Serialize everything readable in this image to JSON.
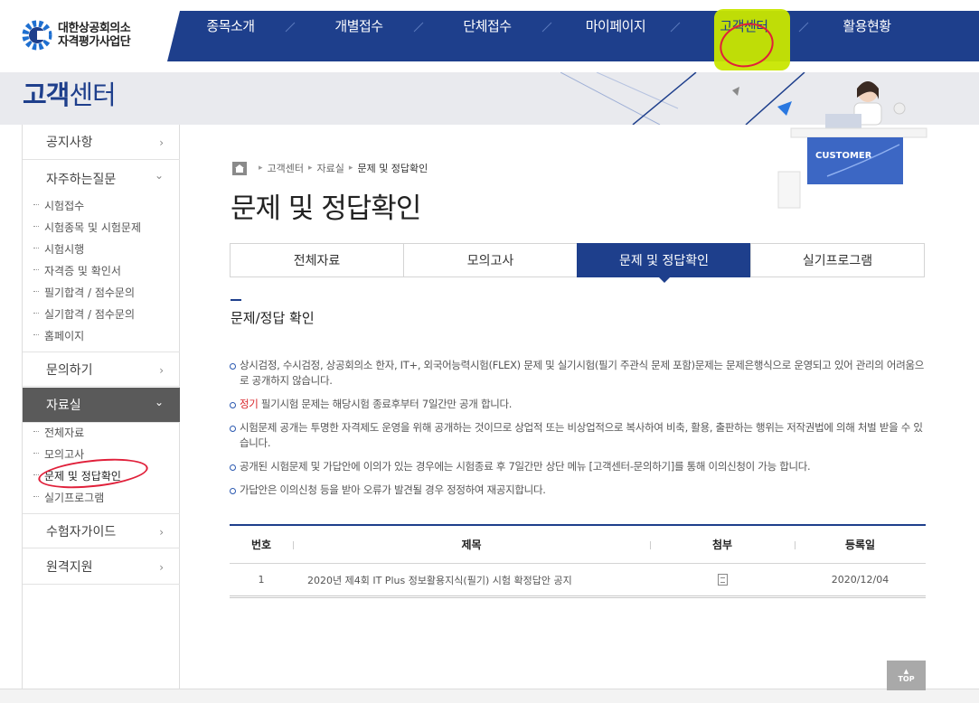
{
  "header": {
    "logo_line1": "대한상공회의소",
    "logo_line2": "자격평가사업단",
    "nav": [
      {
        "label": "종목소개"
      },
      {
        "label": "개별접수"
      },
      {
        "label": "단체접수"
      },
      {
        "label": "마이페이지"
      },
      {
        "label": "고객센터"
      },
      {
        "label": "활용현황"
      }
    ],
    "nav_color": "#1e3f8c"
  },
  "banner": {
    "title_bold": "고객",
    "title_rest": "센터",
    "art_label": "CUSTOMER"
  },
  "sidebar": {
    "items": [
      {
        "label": "공지사항",
        "chevron": "›"
      },
      {
        "label": "자주하는질문",
        "chevron": "⌄"
      },
      {
        "label": "문의하기",
        "chevron": "›"
      },
      {
        "label": "자료실",
        "chevron": "⌄"
      },
      {
        "label": "수험자가이드",
        "chevron": "›"
      },
      {
        "label": "원격지원",
        "chevron": "›"
      }
    ],
    "faq_sub": [
      "시험접수",
      "시험종목 및 시험문제",
      "시험시행",
      "자격증 및 확인서",
      "필기합격 / 점수문의",
      "실기합격 / 점수문의",
      "홈페이지"
    ],
    "archive_sub": [
      "전체자료",
      "모의고사",
      "문제 및 정답확인",
      "실기프로그램"
    ]
  },
  "breadcrumb": {
    "items": [
      "고객센터",
      "자료실"
    ],
    "current": "문제 및 정답확인"
  },
  "page_title": "문제 및 정답확인",
  "tabs": [
    {
      "label": "전체자료"
    },
    {
      "label": "모의고사"
    },
    {
      "label": "문제 및 정답확인"
    },
    {
      "label": "실기프로그램"
    }
  ],
  "section_title": "문제/정답 확인",
  "notices": [
    {
      "text": "상시검정, 수시검정, 상공회의소 한자, IT+, 외국어능력시험(FLEX) 문제 및 실기시험(필기 주관식 문제 포함)문제는 문제은행식으로 운영되고 있어 관리의 어려움으로 공개하지 않습니다."
    },
    {
      "prefix": "정기",
      "text": " 필기시험 문제는 해당시험 종료후부터 7일간만 공개 합니다."
    },
    {
      "text": "시험문제 공개는 투명한 자격제도 운영을 위해 공개하는 것이므로 상업적 또는 비상업적으로 복사하여 비축, 활용, 출판하는 행위는 저작권법에 의해 처벌 받을 수 있습니다."
    },
    {
      "text": "공개된 시험문제 및 가답안에 이의가 있는 경우에는 시험종료 후 7일간만 상단 메뉴 [고객센터-문의하기]를 통해 이의신청이 가능 합니다."
    },
    {
      "text": "가답안은 이의신청 등을 받아 오류가 발견될 경우 정정하여 재공지합니다."
    }
  ],
  "board": {
    "columns": [
      "번호",
      "제목",
      "첨부",
      "등록일"
    ],
    "rows": [
      {
        "no": "1",
        "title": "2020년 제4회 IT Plus 정보활용지식(필기) 시험 확정답안 공지",
        "file_icon": "file-icon",
        "date": "2020/12/04"
      }
    ]
  },
  "top_button": "TOP"
}
